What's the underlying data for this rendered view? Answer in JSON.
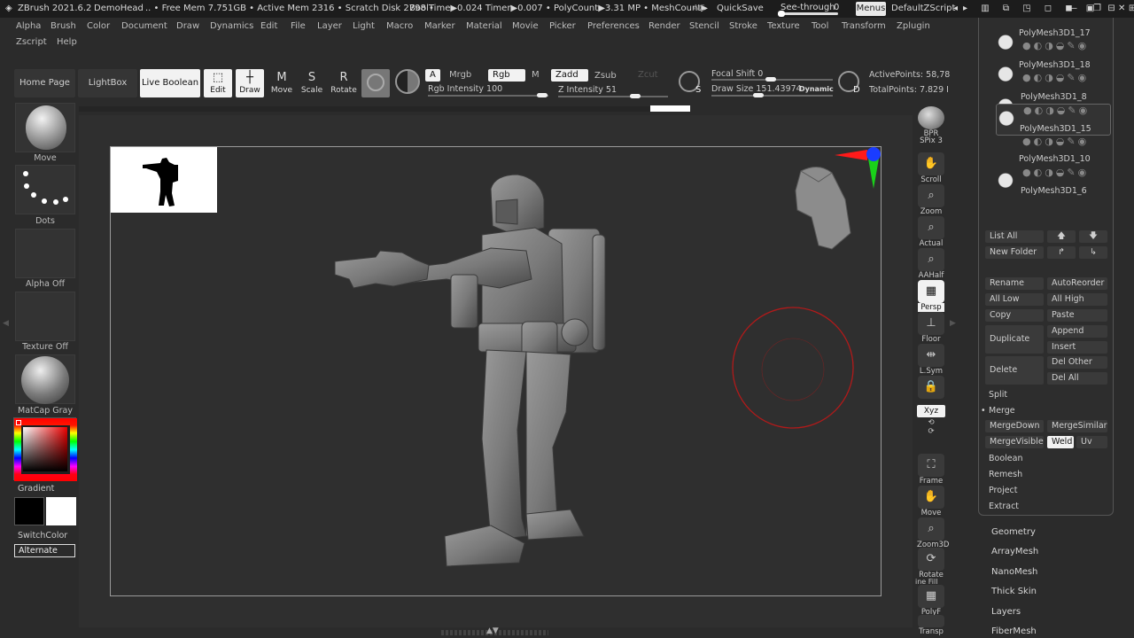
{
  "title_bar": {
    "app": "ZBrush 2021.6.2",
    "doc": "DemoHead",
    "free_mem": ".. • Free Mem 7.751GB • Active Mem 2316 • Scratch Disk 2798 •",
    "bool_time": "BoolTime▶0.024 Timer▶0.007 • PolyCount▶3.31 MP • MeshCount▶",
    "ac": "AC",
    "quicksave": "QuickSave",
    "see_through_label": "See-through",
    "see_through_value": "0",
    "menus": "Menus",
    "zscript": "DefaultZScript"
  },
  "menu_row1": [
    "Alpha",
    "Brush",
    "Color",
    "Document",
    "Draw",
    "Dynamics",
    "Edit",
    "File",
    "Layer",
    "Light",
    "Macro",
    "Marker",
    "Material",
    "Movie",
    "Picker",
    "Preferences",
    "Render",
    "Stencil",
    "Stroke",
    "Texture",
    "Tool",
    "Transform",
    "Zplugin"
  ],
  "menu_row2": [
    "Zscript",
    "Help"
  ],
  "shelf": {
    "home": "Home Page",
    "lightbox": "LightBox",
    "live_boolean": "Live Boolean",
    "edit": "Edit",
    "draw": "Draw",
    "move": "Move",
    "scale": "Scale",
    "rotate": "Rotate",
    "a": "A",
    "mrgb": "Mrgb",
    "rgb": "Rgb",
    "m": "M",
    "zadd": "Zadd",
    "zsub": "Zsub",
    "zcut": "Zcut",
    "rgb_intensity": "Rgb Intensity 100",
    "z_intensity": "Z Intensity 51",
    "focal_shift": "Focal Shift 0",
    "draw_size": "Draw Size 151.43974",
    "dynamic": "Dynamic",
    "s": "S",
    "d": "D",
    "active_points": "ActivePoints: 58,78",
    "total_points": "TotalPoints: 7.829 I"
  },
  "left_tray": {
    "move": "Move",
    "dots": "Dots",
    "alpha": "Alpha Off",
    "texture": "Texture Off",
    "matcap": "MatCap Gray",
    "gradient": "Gradient",
    "switch": "SwitchColor",
    "alternate": "Alternate"
  },
  "right_tray": {
    "bpr": "BPR",
    "spix": "SPix 3",
    "scroll": "Scroll",
    "zoom": "Zoom",
    "actual": "Actual",
    "aahalf": "AAHalf",
    "persp": "Persp",
    "floor": "Floor",
    "lsym": "L.Sym",
    "xyz": "Xyz",
    "frame": "Frame",
    "move": "Move",
    "zoom3d": "Zoom3D",
    "rotate": "Rotate",
    "linefill": "ine Fill",
    "polyf": "PolyF",
    "transp": "Transp"
  },
  "subtools": [
    "PolyMesh3D1_17",
    "PolyMesh3D1_18",
    "PolyMesh3D1_8",
    "PolyMesh3D1_15",
    "PolyMesh3D1_10",
    "PolyMesh3D1_6"
  ],
  "subtool_buttons": {
    "list_all": "List All",
    "new_folder": "New Folder",
    "rename": "Rename",
    "autoreorder": "AutoReorder",
    "all_low": "All Low",
    "all_high": "All High",
    "copy": "Copy",
    "paste": "Paste",
    "duplicate": "Duplicate",
    "append": "Append",
    "insert": "Insert",
    "delete": "Delete",
    "del_other": "Del Other",
    "del_all": "Del All",
    "split": "Split",
    "merge": "Merge",
    "mergedown": "MergeDown",
    "mergesimilar": "MergeSimilar",
    "mergevisible": "MergeVisible",
    "weld": "Weld",
    "uv": "Uv",
    "boolean": "Boolean",
    "remesh": "Remesh",
    "project": "Project",
    "extract": "Extract"
  },
  "categories": [
    "Geometry",
    "ArrayMesh",
    "NanoMesh",
    "Thick Skin",
    "Layers",
    "FiberMesh"
  ],
  "colors": {
    "brush_circle": "#b11a1a",
    "axis_red": "#ff1a1a",
    "axis_green": "#1ad11a",
    "axis_blue": "#1a3cff"
  }
}
